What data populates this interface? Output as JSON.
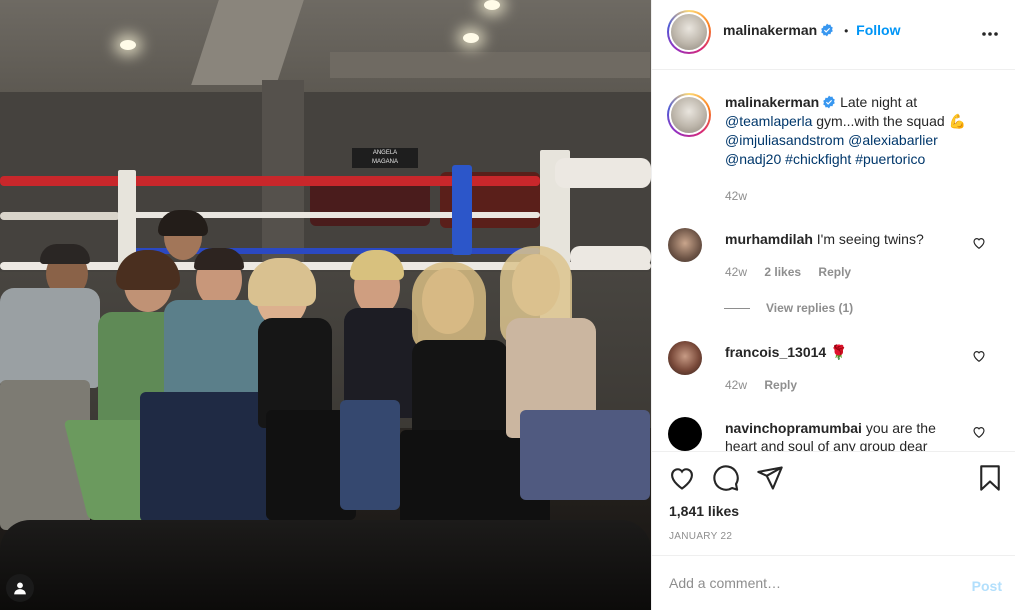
{
  "post": {
    "author": "malinakerman",
    "verified": true,
    "follow_label": "Follow",
    "separator": "•"
  },
  "caption": {
    "username": "malinakerman",
    "text_1": "Late night at",
    "mention_1": "@teamlaperla",
    "text_2": "gym...with the squad",
    "emoji": "💪",
    "mention_2": "@imjuliasandstrom",
    "mention_3": "@alexiabarlier",
    "mention_4": "@nadj20",
    "hashtag_1": "#chickfight",
    "hashtag_2": "#puertorico",
    "time": "42w"
  },
  "comments": [
    {
      "username": "murhamdilah",
      "text": "I'm seeing twins?",
      "time": "42w",
      "likes": "2 likes",
      "reply_label": "Reply",
      "view_replies": "View replies (1)"
    },
    {
      "username": "francois_13014",
      "text": "🌹",
      "time": "42w",
      "reply_label": "Reply"
    },
    {
      "username": "navinchopramumbai",
      "text": "you are the heart and soul of any group dear"
    }
  ],
  "engagement": {
    "likes": "1,841 likes",
    "date": "JANUARY 22"
  },
  "comment_box": {
    "placeholder": "Add a comment…",
    "post_label": "Post"
  },
  "photo": {
    "sign_line1": "ANGELA",
    "sign_line2": "MAGANA"
  },
  "colors": {
    "accent": "#0095f6",
    "link": "#00376b",
    "muted": "#8e8e8e",
    "post_disabled": "#b2dffc"
  },
  "icons": [
    "verified-badge-icon",
    "more-options-icon",
    "heart-icon",
    "comment-icon",
    "share-icon",
    "bookmark-icon",
    "user-tag-icon"
  ]
}
